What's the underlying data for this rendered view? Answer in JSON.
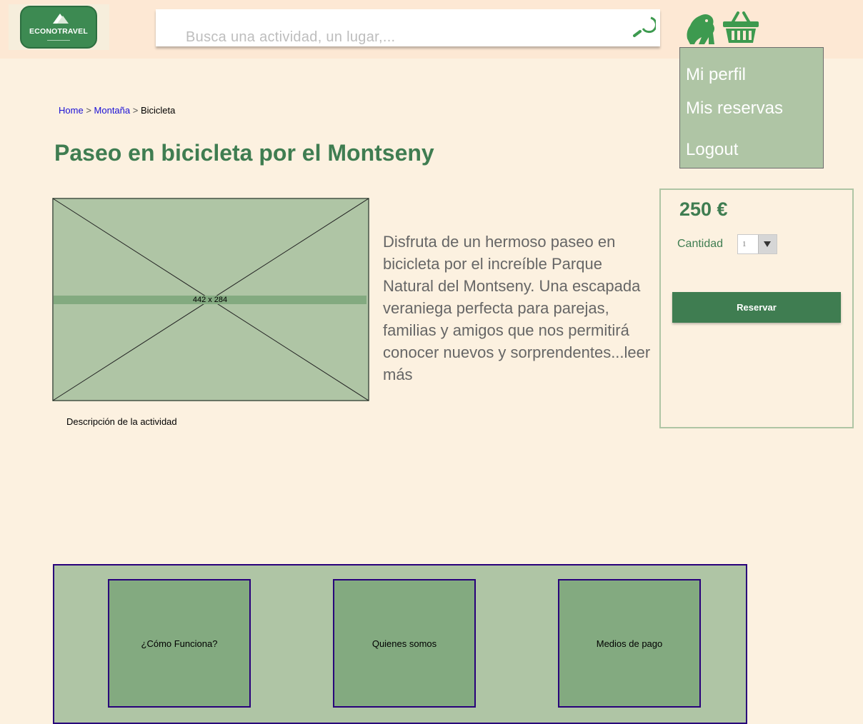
{
  "header": {
    "logo": {
      "name": "ECONOTRAVEL"
    },
    "search": {
      "placeholder": "Busca una actividad, un lugar,..."
    },
    "icons": [
      "gorilla-icon",
      "shopping-basket-icon",
      "search-icon"
    ]
  },
  "user_menu": {
    "items": [
      {
        "label": "Mi perfil"
      },
      {
        "label": "Mis reservas"
      },
      {
        "label": "Logout"
      }
    ]
  },
  "breadcrumb": {
    "home": "Home",
    "sep": ">",
    "category": "Montaña",
    "current": "Bicicleta"
  },
  "activity": {
    "title": "Paseo en bicicleta por el Montseny",
    "image_placeholder_label": "442 x 284",
    "image_caption": "Descripción de la actividad",
    "description": "Disfruta de un hermoso paseo en bicicleta por el increíble Parque Natural del Montseny. Una escapada veraniega perfecta para parejas, familias y amigos que nos permitirá conocer nuevos y sorprendentes...leer más"
  },
  "booking": {
    "price": "250 €",
    "quantity_label": "Cantidad",
    "quantity_value": "1",
    "reserve_label": "Reservar"
  },
  "footer": {
    "links": [
      {
        "label": "¿Cómo Funciona?"
      },
      {
        "label": "Quienes somos"
      },
      {
        "label": "Medios de pago"
      }
    ]
  },
  "colors": {
    "accent_green": "#3f7d51",
    "sage": "#afc5a5",
    "header_bg": "#fde8d4",
    "page_bg": "#fcf1e0",
    "footer_border": "#28007a"
  }
}
